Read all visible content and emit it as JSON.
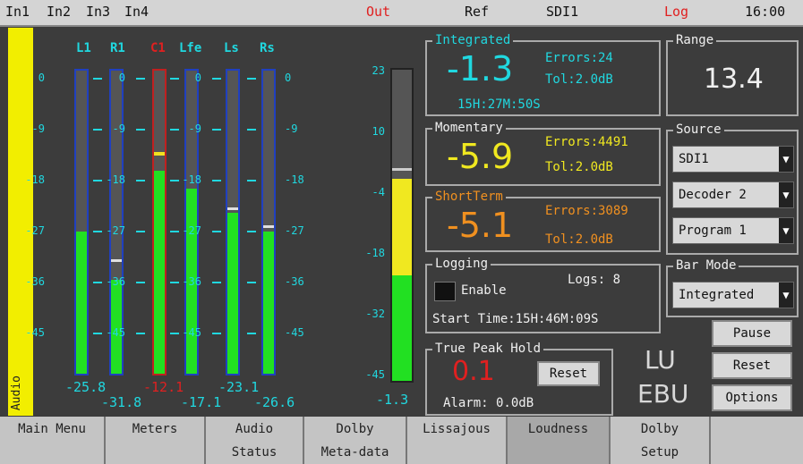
{
  "topbar": {
    "inputs": [
      "In1",
      "In2",
      "In3",
      "In4"
    ],
    "out": "Out",
    "ref": "Ref",
    "source": "SDI1",
    "log": "Log",
    "time": "16:00"
  },
  "side_label": "Audio",
  "meters": {
    "channels": [
      {
        "label": "L1",
        "readout": "-25.8",
        "level": 0.47,
        "peak": null,
        "color": "#20d8e0"
      },
      {
        "label": "R1",
        "readout": "-31.8",
        "level": 0.31,
        "peak": 0.37,
        "color": "#20d8e0"
      },
      {
        "label": "C1",
        "readout": "-12.1",
        "level": 0.67,
        "peak": 0.72,
        "color": "#e02020"
      },
      {
        "label": "Lfe",
        "readout": "-17.1",
        "level": 0.61,
        "peak": null,
        "color": "#20d8e0"
      },
      {
        "label": "Ls",
        "readout": "-23.1",
        "level": 0.53,
        "peak": 0.54,
        "color": "#20d8e0"
      },
      {
        "label": "Rs",
        "readout": "-26.6",
        "level": 0.47,
        "peak": 0.48,
        "color": "#20d8e0"
      }
    ],
    "scale": [
      "0",
      "-9",
      "-18",
      "-27",
      "-36",
      "-45"
    ]
  },
  "loudness_bar": {
    "scale": [
      "23",
      "10",
      "-4",
      "-18",
      "-32",
      "-45"
    ],
    "readout": "-1.3",
    "yellow_level": 0.65,
    "green_level": 0.34
  },
  "integrated": {
    "title": "Integrated",
    "value": "-1.3",
    "errors": "Errors:24",
    "tol": "Tol:2.0dB",
    "duration": "15H:27M:50S"
  },
  "momentary": {
    "title": "Momentary",
    "value": "-5.9",
    "errors": "Errors:4491",
    "tol": "Tol:2.0dB"
  },
  "shortterm": {
    "title": "ShortTerm",
    "value": "-5.1",
    "errors": "Errors:3089",
    "tol": "Tol:2.0dB"
  },
  "logging": {
    "title": "Logging",
    "enable_label": "Enable",
    "logs": "Logs: 8",
    "start_time": "Start Time:15H:46M:09S"
  },
  "truepeak": {
    "title": "True Peak Hold",
    "value": "0.1",
    "reset_label": "Reset",
    "alarm": "Alarm: 0.0dB"
  },
  "range": {
    "title": "Range",
    "value": "13.4"
  },
  "source": {
    "title": "Source",
    "options": [
      "SDI1",
      "Decoder 2",
      "Program 1"
    ]
  },
  "barmode": {
    "title": "Bar Mode",
    "value": "Integrated"
  },
  "buttons": {
    "pause": "Pause",
    "reset": "Reset",
    "options": "Options"
  },
  "logos": {
    "lu": "LU",
    "ebu": "EBU"
  },
  "nav": [
    {
      "line1": "Main Menu",
      "line2": ""
    },
    {
      "line1": "Meters",
      "line2": ""
    },
    {
      "line1": "Audio",
      "line2": "Status"
    },
    {
      "line1": "Dolby",
      "line2": "Meta-data"
    },
    {
      "line1": "Lissajous",
      "line2": ""
    },
    {
      "line1": "Loudness",
      "line2": ""
    },
    {
      "line1": "Dolby",
      "line2": "Setup"
    },
    {
      "line1": "",
      "line2": ""
    }
  ],
  "colors": {
    "cyan": "#20d8e0",
    "green": "#22e022",
    "yellow": "#f0e820",
    "orange": "#f09020",
    "red": "#e02020"
  }
}
